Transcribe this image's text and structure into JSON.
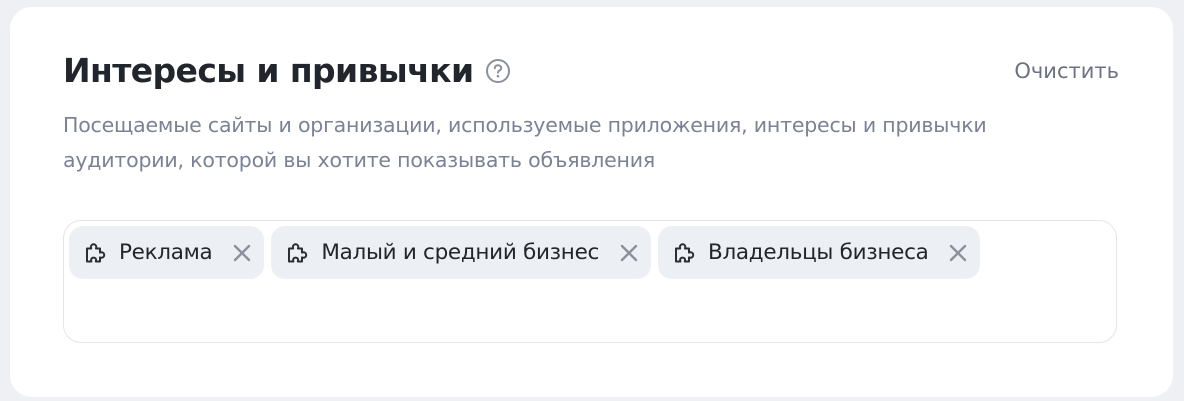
{
  "section": {
    "title": "Интересы и привычки",
    "help_icon": "question-circle-icon",
    "clear_label": "Очистить",
    "description": "Посещаемые сайты и организации, используемые приложения, интересы и привычки аудитории, которой вы хотите показывать объявления"
  },
  "tags": [
    {
      "label": "Реклама",
      "icon": "puzzle-icon"
    },
    {
      "label": "Малый и средний бизнес",
      "icon": "puzzle-icon"
    },
    {
      "label": "Владельцы бизнеса",
      "icon": "puzzle-icon"
    }
  ],
  "colors": {
    "title": "#21262d",
    "muted": "#7a8293",
    "tag_bg": "#eceff3",
    "border": "#e2e5ea"
  }
}
